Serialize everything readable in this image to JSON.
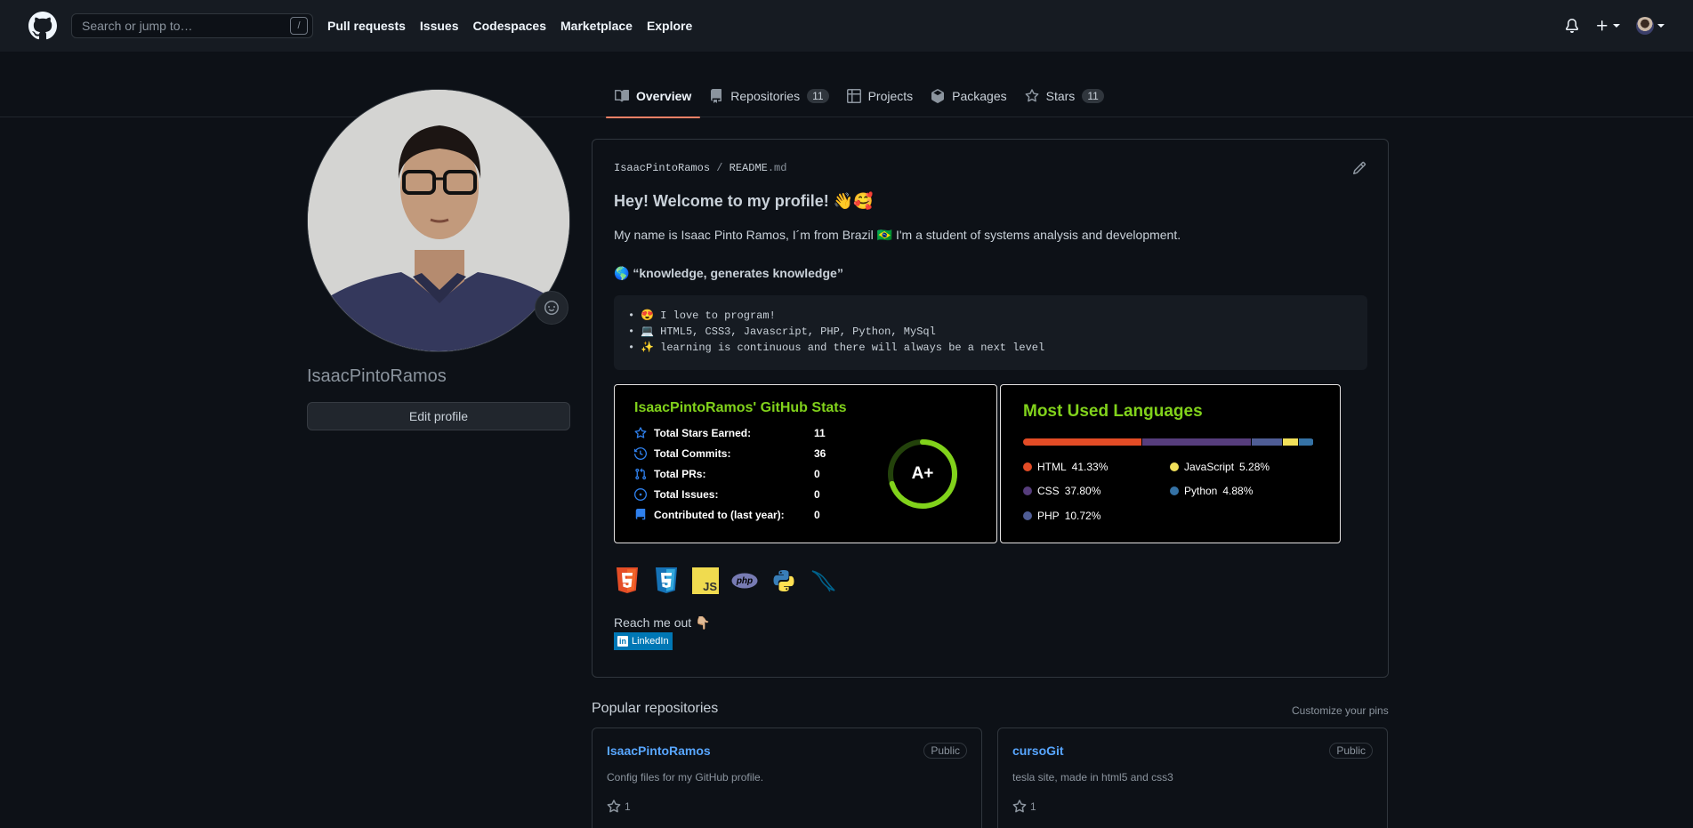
{
  "header": {
    "search_placeholder": "Search or jump to…",
    "search_key": "/",
    "nav": [
      "Pull requests",
      "Issues",
      "Codespaces",
      "Marketplace",
      "Explore"
    ]
  },
  "tabs": [
    {
      "label": "Overview",
      "active": true
    },
    {
      "label": "Repositories",
      "count": "11"
    },
    {
      "label": "Projects"
    },
    {
      "label": "Packages"
    },
    {
      "label": "Stars",
      "count": "11"
    }
  ],
  "profile": {
    "username": "IsaacPintoRamos",
    "edit_label": "Edit profile"
  },
  "readme": {
    "crumb_user": "IsaacPintoRamos",
    "crumb_sep": "/",
    "crumb_file": "README",
    "crumb_ext": ".md",
    "greeting": "Hey! Welcome to my profile! 👋🥰",
    "intro": "My name is Isaac Pinto Ramos, I´m from Brazil 🇧🇷 I'm a student of systems analysis and development.",
    "quote": "🌎 “knowledge, generates knowledge”",
    "bullets": [
      "😍 I love to program!",
      "💻 HTML5, CSS3, Javascript, PHP, Python, MySql",
      "✨ learning is continuous and there will always be a next level"
    ],
    "stats": {
      "title": "IsaacPintoRamos' GitHub Stats",
      "rows": [
        {
          "label": "Total Stars Earned:",
          "value": "11",
          "icon": "star-icon"
        },
        {
          "label": "Total Commits:",
          "value": "36",
          "icon": "history-icon"
        },
        {
          "label": "Total PRs:",
          "value": "0",
          "icon": "pull-request-icon"
        },
        {
          "label": "Total Issues:",
          "value": "0",
          "icon": "issue-icon"
        },
        {
          "label": "Contributed to (last year):",
          "value": "0",
          "icon": "repo-icon"
        }
      ],
      "grade": "A+",
      "grade_progress": 0.7,
      "accent": "#81d21b"
    },
    "languages": {
      "title": "Most Used Languages",
      "items": [
        {
          "name": "HTML",
          "percent": "41.33%",
          "value": 41.33,
          "color": "#e34c26"
        },
        {
          "name": "CSS",
          "percent": "37.80%",
          "value": 37.8,
          "color": "#563d7c"
        },
        {
          "name": "PHP",
          "percent": "10.72%",
          "value": 10.72,
          "color": "#4f5d95"
        },
        {
          "name": "JavaScript",
          "percent": "5.28%",
          "value": 5.28,
          "color": "#f1e05a"
        },
        {
          "name": "Python",
          "percent": "4.88%",
          "value": 4.88,
          "color": "#3572a5"
        }
      ]
    },
    "tech_icons": [
      "html5-icon",
      "css3-icon",
      "javascript-icon",
      "php-icon",
      "python-icon",
      "mysql-icon"
    ],
    "js_label": "JS",
    "php_label": "php",
    "reach": "Reach me out 👇🏼",
    "linkedin_label": "LinkedIn",
    "linkedin_in": "in"
  },
  "popular": {
    "title": "Popular repositories",
    "customize": "Customize your pins",
    "repos": [
      {
        "name": "IsaacPintoRamos",
        "visibility": "Public",
        "desc": "Config files for my GitHub profile.",
        "stars": "1"
      },
      {
        "name": "cursoGit",
        "visibility": "Public",
        "desc": "tesla site, made in html5 and css3",
        "stars": "1"
      }
    ]
  }
}
